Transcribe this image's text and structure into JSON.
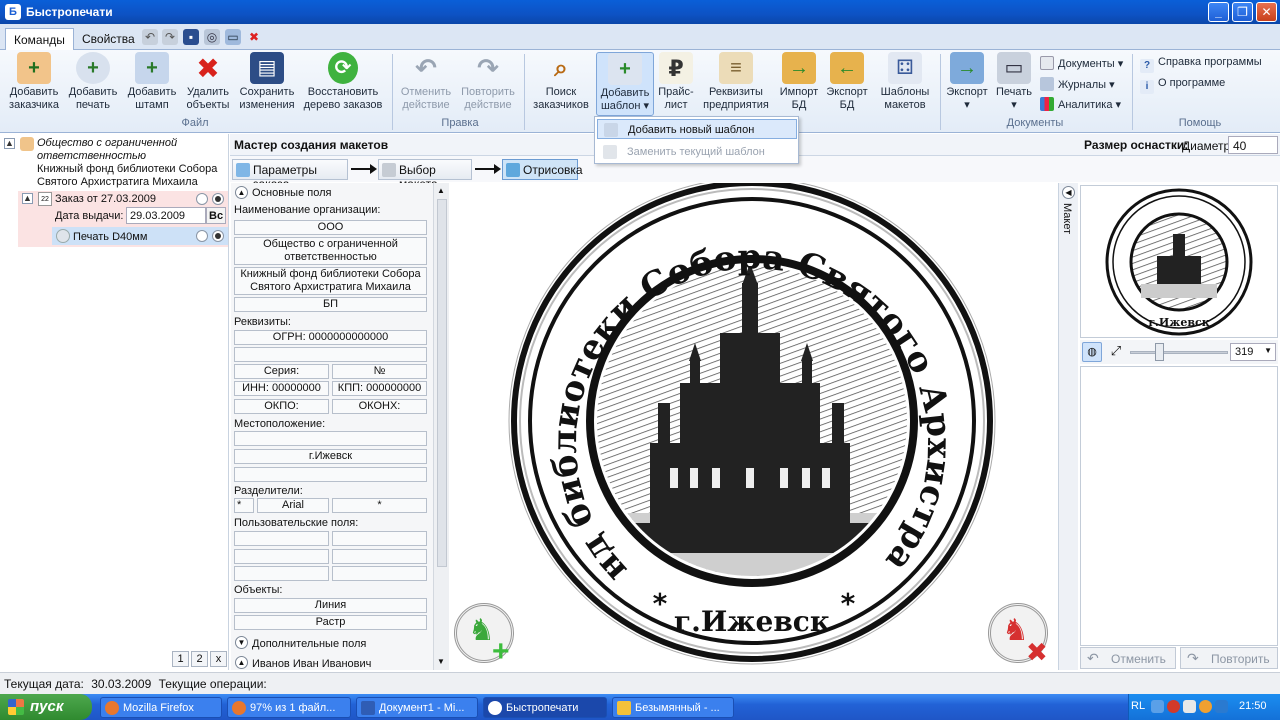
{
  "window": {
    "title": "Быстропечати"
  },
  "tabs": [
    "Команды",
    "Свойства"
  ],
  "ribbon": {
    "buttons": [
      {
        "label": "Добавить заказчика"
      },
      {
        "label": "Добавить печать"
      },
      {
        "label": "Добавить штамп"
      },
      {
        "label": "Удалить объекты"
      },
      {
        "label": "Сохранить изменения"
      },
      {
        "label": "Восстановить дерево заказов"
      },
      {
        "label": "Отменить действие"
      },
      {
        "label": "Повторить действие"
      },
      {
        "label": "Поиск заказчиков"
      },
      {
        "label": "Добавить шаблон"
      },
      {
        "label": "Прайс-лист"
      },
      {
        "label": "Реквизиты предприятия"
      },
      {
        "label": "Импорт БД"
      },
      {
        "label": "Экспорт БД"
      },
      {
        "label": "Шаблоны макетов"
      },
      {
        "label": "Экспорт"
      },
      {
        "label": "Печать"
      }
    ],
    "groups": {
      "file": "Файл",
      "edit": "Правка",
      "documents": "Документы",
      "help": "Помощь"
    },
    "small": {
      "documents": "Документы",
      "journals": "Журналы",
      "analytics": "Аналитика",
      "help": "Справка программы",
      "about": "О программе"
    },
    "dropdown": {
      "add_new": "Добавить новый шаблон",
      "replace": "Заменить текущий шаблон"
    }
  },
  "tree": {
    "org": "Общество с ограниченной ответственностью",
    "org2": "Книжный фонд библиотеки Собора Святого Архистратига Михаила",
    "order": "Заказ от 27.03.2009",
    "issue_label": "Дата выдачи:",
    "issue_date": "29.03.2009",
    "issue_btn": "Вс",
    "stamp": "Печать D40мм",
    "pages": [
      "1",
      "2",
      "x"
    ]
  },
  "master": {
    "title": "Мастер создания макетов",
    "size_label": "Размер оснастки:",
    "diameter_label": "Диаметр",
    "diameter_value": "40",
    "steps": [
      "Параметры заказа",
      "Выбор макета",
      "Отрисовка"
    ]
  },
  "form": {
    "basic": "Основные поля",
    "org_name_label": "Наименование организации:",
    "org_type": "ООО",
    "org_full": "Общество с ограниченной ответственностью",
    "org_lib": "Книжный фонд библиотеки Собора Святого Архистратига Михаила",
    "org_short": "БП",
    "req_label": "Реквизиты:",
    "ogrn": "ОГРН: 0000000000000",
    "series": "Серия:",
    "number": "№",
    "inn": "ИНН: 00000000",
    "kpp": "КПП: 000000000",
    "okpo": "ОКПО:",
    "okonh": "ОКОНХ:",
    "location_label": "Местоположение:",
    "city": "г.Ижевск",
    "separators_label": "Разделители:",
    "sep1": "*",
    "font": "Arial",
    "sep2": "*",
    "custom_label": "Пользовательские поля:",
    "objects_label": "Объекты:",
    "line": "Линия",
    "raster": "Растр",
    "extra": "Дополнительные поля",
    "person": "Иванов Иван Иванович"
  },
  "stamp": {
    "ring_text": "Книжный фонд библиотеки Собора Святого Архистратига Михаила",
    "city": "г.Ижевск",
    "star": "*"
  },
  "side": {
    "tab": "Макет",
    "zoom": "319",
    "undo": "Отменить",
    "redo": "Повторить"
  },
  "status": {
    "date_label": "Текущая дата:",
    "date": "30.03.2009",
    "ops_label": "Текущие операции:"
  },
  "taskbar": {
    "start": "пуск",
    "tasks": [
      "Mozilla Firefox",
      "97% из 1 файл...",
      "Документ1 - Mi...",
      "Быстропечати",
      "Безымянный - ..."
    ],
    "lang": "RL",
    "time": "21:50"
  }
}
